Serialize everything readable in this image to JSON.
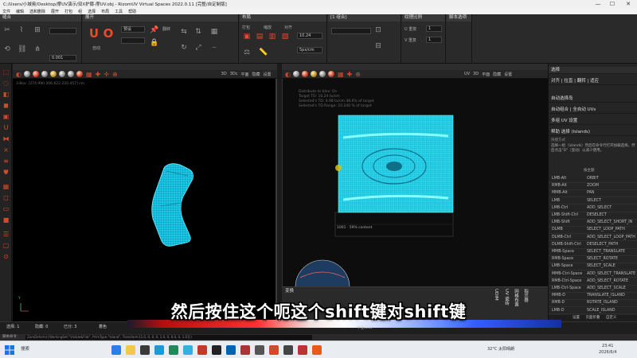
{
  "window": {
    "path_title": "C:/Users/小城奥/Desktop/摩UV演示/双X护膝-摩UV.obj - RizomUV Virtual Spaces 2022.0.11 [完整/自定制版]",
    "controls": [
      "—",
      "☐",
      "✕"
    ]
  },
  "menu": [
    "文件",
    "编辑",
    "选和删除",
    "展开",
    "打包",
    "组",
    "选择",
    "布局",
    "工具",
    "帮助"
  ],
  "ribbon": {
    "groups": [
      {
        "title": "缝合"
      },
      {
        "title": "展开",
        "labels": [
          "自动",
          "预设",
          "翻转"
        ]
      },
      {
        "title": "布局",
        "labels": [
          "打包",
          "缩放",
          "对齐"
        ]
      },
      {
        "title": "[1 组合]"
      },
      {
        "title": "纹理比例",
        "fields": [
          "U 重复",
          "V 重复"
        ],
        "values": [
          "1",
          "1"
        ]
      },
      {
        "title": "脚本选项"
      }
    ],
    "value_1024": "10.24",
    "value_0001": "0.001",
    "value_5px": "5px/cm"
  },
  "viewport_3d": {
    "tabs": [
      "3D",
      "3Dc",
      "平面",
      "隐藏",
      "设置"
    ],
    "info": "3-Box: [274.990 306.622 220.457] cm",
    "axis_label": "Y"
  },
  "viewport_uv": {
    "tabs": [
      "UV",
      "3D",
      "平面",
      "隐藏",
      "设置"
    ],
    "info_lines": [
      "Distribute to tiles: On",
      "Target TD: 10.24 tx/cm",
      "Selected's TD: 4.98 tx/cm 48.6% of target",
      "Selected's TD Range: 10.240 % of target"
    ],
    "tile_label": "1001 · 59% content"
  },
  "transform_panel": {
    "title": "变换",
    "vertical_labels": [
      "UDIM",
      "UV 瓷砖",
      "网格布置",
      "指示器"
    ]
  },
  "right_panel": {
    "header": "选择",
    "items": [
      "对齐 | 拉直 | 翻转 | 适应",
      "自动选择岛",
      "自动组合 | 全自动 UVs",
      "多组 UV 设置",
      "帮助 选择 (Islands)"
    ],
    "help_title": "快捷方式",
    "help_text": "选择一组（islands）然后在命令行打开加载选择。然后点击\"D\"（变动）以减少使用。",
    "shortcuts_title": "按主题",
    "shortcuts": [
      {
        "key": "LMB-Alt",
        "action": "ORBIT"
      },
      {
        "key": "RMB-Alt",
        "action": "ZOOM"
      },
      {
        "key": "MMB-Alt",
        "action": "PAN"
      },
      {
        "key": "LMB",
        "action": "SELECT"
      },
      {
        "key": "LMB-Ctrl",
        "action": "ADD_SELECT"
      },
      {
        "key": "LMB-Shift-Ctrl",
        "action": "DESELECT"
      },
      {
        "key": "LMB-Shift",
        "action": "ADD_SELECT_SHORT_IN"
      },
      {
        "key": "DLMB",
        "action": "SELECT_LOOP_PATH"
      },
      {
        "key": "DLMB-Ctrl",
        "action": "ADD_SELECT_LOOP_PATH"
      },
      {
        "key": "DLMB-Shift-Ctrl",
        "action": "DESELECT_PATH"
      },
      {
        "key": "MMB-Space",
        "action": "SELECT_TRANSLATE"
      },
      {
        "key": "RMB-Space",
        "action": "SELECT_ROTATE"
      },
      {
        "key": "LMB-Space",
        "action": "SELECT_SCALE"
      },
      {
        "key": "MMB-Ctrl-Space",
        "action": "ADD_SELECT_TRANSLATE"
      },
      {
        "key": "RMB-Ctrl-Space",
        "action": "ADD_SELECT_ROTATE"
      },
      {
        "key": "LMB-Ctrl-Space",
        "action": "ADD_SELECT_SCALE"
      },
      {
        "key": "MMB-D",
        "action": "TRANSLATE_ISLAND"
      },
      {
        "key": "RMB-D",
        "action": "ROTATE_ISLAND"
      },
      {
        "key": "LMB-D",
        "action": "SCALE_ISLAND"
      }
    ],
    "footer_buttons": [
      "设置",
      "页面折叠",
      "自定义"
    ]
  },
  "bottom": {
    "status_left": [
      "选择: 1",
      "隐藏: 0",
      "已分: 3"
    ],
    "status_mid": "着色",
    "slider_label": "中性(1.0)",
    "cmd_label": "脚本命令",
    "cmd_text": "ZomDeform({WorkingSet:\"Visible&Flat\", PrimType:\"Island\", Transform:[1.0, 0, 0, 0, 1.0, 0, 0.0, 0, 1.0]})"
  },
  "taskbar": {
    "search_label": "搜索",
    "weather": "32°C 太阳晴朗",
    "time": "23:41",
    "date": "2026/6/4"
  },
  "subtitle": "然后按住这个呃这个shift键对shift键",
  "colors": {
    "mesh": "#22d8f0",
    "accent": "#e84a2a"
  }
}
